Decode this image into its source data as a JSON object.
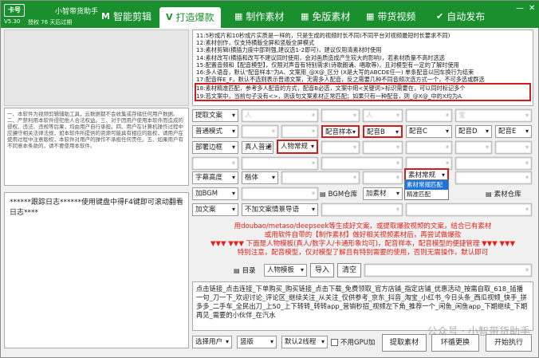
{
  "app": {
    "title": "小智带货助手",
    "version": "V5.30",
    "trial": "授权 76 天后过期",
    "logo": "卡号"
  },
  "tabs": [
    {
      "label": "智能剪辑",
      "icon": "M"
    },
    {
      "label": "打造爆款",
      "icon": "V"
    },
    {
      "label": "制作素材",
      "icon": "▦"
    },
    {
      "label": "免版素材",
      "icon": "▦"
    },
    {
      "label": "带货视频",
      "icon": "▦"
    },
    {
      "label": "自动发布",
      "icon": "✔"
    }
  ],
  "rules": [
    "11:5秒成片和10秒成片实质是一样的，只是生成的视频时长不同(不同平台对视频最短时长要求不同)",
    "12:素材创作，仅支持横版全屏和竖版全屏模式",
    "13:素材剪辑(横插力度中部到强,建议选1-2即可)，建议仅用清素材时使用",
    "14:素材改写(横插和改写不建议同时使用，会对画质造成产生较大的影响)，若素材质量不高时选选",
    "15:配置音频和【配音模型】，仅限对声音有特别需求(诗歌朗诵、唱歌等)，且对模型有一定的了解时使用",
    "16:多人语音，默认\"配音样本\"为A、文案用_@X@_区分 (X是大写的ABCDE任一) 单条配音以回车换行为结束",
    "17:配音样E_F，默认不选则表示普通文案，无需多人配音，反之需要几种不同音频次选方式一个，不可多选或群选",
    "18:素材精准匹配，参考多人配音的方式，配音B必选，文案中用<关键词>标识需要在，可以同时标记多个",
    "19:若文案中，当前句子没有<>，则该句文案素材正常匹配；如果只有一种配音，则_@X@_中的X均为A"
  ],
  "notes": "一、本软件为视频剪辑辅助工具，云数据都不会收集或存储任何用户数据。二、严禁利用本软件侵犯他人合法权益。三、对于因用户使用本软件而造成的侵权、违法、违规等后果，均由用户自行承担。四、用户在计算机操作过程中应遵守相关法律法规，如本软件所提供的资源可能具有相应的版权，请用户在使用过程中注意版权，本软件对用户的操作不承担任何责任。五、如果用户有不同意本条款的，请不要使用本软件。",
  "log": "******跟踪日志******使用键盘中得F4键即可滚动翻看日志****",
  "row1": {
    "extract": "提取文案",
    "f1": "人",
    "f2": "",
    "f3": "人",
    "f4": "",
    "f5": "宝"
  },
  "row2": {
    "voice": "普通模式",
    "f1": "",
    "f2": "",
    "sample": "配音样本",
    "voiceB": "配音B",
    "voiceC": "配音C",
    "voiceD": "配音D",
    "voiceE": "配音E"
  },
  "row3": {
    "edge": "部署边框",
    "realvoice": "真人普通",
    "character": "人物常规",
    "f1": "",
    "f2": "",
    "f3": "",
    "f4": "",
    "f5": ""
  },
  "row4": {
    "a": "",
    "b": "",
    "c": "",
    "d": "",
    "e": ""
  },
  "row5": {
    "subtitle": "字幕高度",
    "font": "楷体",
    "f1": "",
    "f2": "",
    "material": "素材常规",
    "f3": ""
  },
  "row6": {
    "bgm": "加BGM",
    "bgmwh": "BGM仓库",
    "title": "加素材",
    "matwh": "素材仓库"
  },
  "row7": {
    "text": "加文案",
    "textopt": "不加文案情景导语",
    "f1": "",
    "f2": ""
  },
  "dropdown": {
    "opt1": "素材常规匹配",
    "opt2": "精准匹配"
  },
  "red_lines": [
    "用doubao/metaso/deepseek等生成好文案，或提取爆款视频的文案，结合已有素材",
    "或用软件自带的【制作素材】做好相关视频素材后，再尝试做爆款",
    "▼▼▼ ▼▼▼ 下面是人物模板(真人/数字人/卡通形象均可)，配音样本，配音模型的便捷管理 ▼▼▼ ▼▼▼",
    "特别注意，配音模型，仅对模型了解且有特别需要的使用，否则无需操作，默认即可"
  ],
  "catalog": {
    "label": "目录",
    "template": "人物模板",
    "import": "导入",
    "clear": "清空"
  },
  "body_text": "点击链接_点击连接_下单购买_购买链接_点击下载_免费领取_官方店铺_指定店铺_优惠活动_按需自取_618_插播一句_刀一下_欢迎讨论_评论区_继续关注_从关注_仅供参考_京东_抖音_淘宝_小红书_今日头条_西瓜视频_快手_拼多多_二手车_全民出刀_上50_上下转转_转转app_营销秒招_视频左下角_推荐一个_闲鱼_闲鱼app_下期继续_下期再见_需要的小伙伴_在汽水",
  "bottom": {
    "selectuser": "选择用户",
    "orient": "竖版",
    "threads": "默认2线程",
    "gpu": "不用GPU加",
    "extract": "提取素材",
    "loop": "环循更换",
    "start": "开始执行"
  },
  "watermark": "公众号 · 小智带货助手"
}
